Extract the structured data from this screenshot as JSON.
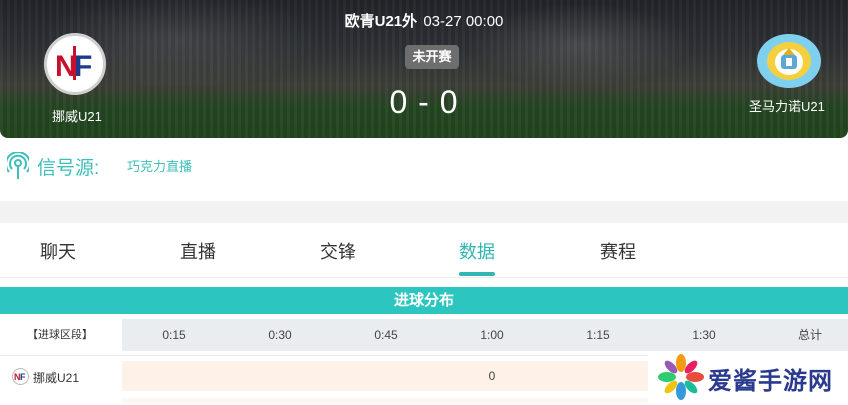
{
  "match": {
    "competition": "欧青U21外",
    "datetime": "03-27 00:00",
    "status": "未开赛",
    "score": "0 - 0",
    "home_team": "挪威U21",
    "away_team": "圣马力诺U21"
  },
  "signal": {
    "label": "信号源:",
    "source": "巧克力直播"
  },
  "tabs": [
    {
      "label": "聊天",
      "active": false
    },
    {
      "label": "直播",
      "active": false
    },
    {
      "label": "交锋",
      "active": false
    },
    {
      "label": "数据",
      "active": true
    },
    {
      "label": "赛程",
      "active": false
    }
  ],
  "goal_distribution": {
    "title": "进球分布",
    "row_header": "【进球区段】",
    "columns": [
      "0:15",
      "0:30",
      "0:45",
      "1:00",
      "1:15",
      "1:30",
      "总计"
    ],
    "rows": [
      {
        "team": "挪威U21",
        "value": "0"
      }
    ]
  },
  "watermark": {
    "text": "爱酱手游网"
  },
  "colors": {
    "accent": "#32b5b5",
    "section_header": "#2cc5c0",
    "status_badge": "#6e6e6e",
    "row_highlight": "#fdf1e8"
  }
}
